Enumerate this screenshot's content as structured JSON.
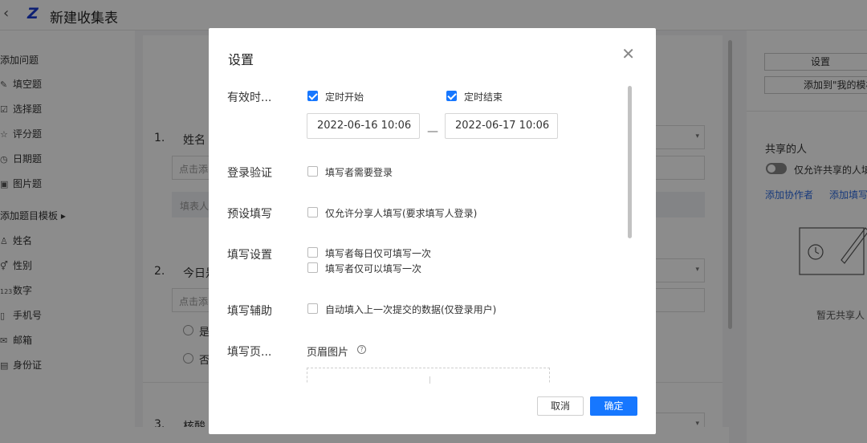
{
  "app": {
    "back_icon": "chevron-left-icon",
    "logo": "Z",
    "title": "新建收集表"
  },
  "sidebar": {
    "add_question": "添加问题",
    "items": [
      {
        "label": "填空题",
        "icon": "pencil-icon",
        "glyph": "✎"
      },
      {
        "label": "选择题",
        "icon": "checkbox-icon",
        "glyph": "☑"
      },
      {
        "label": "评分题",
        "icon": "star-icon",
        "glyph": "☆"
      },
      {
        "label": "日期题",
        "icon": "clock-icon",
        "glyph": "◷"
      },
      {
        "label": "图片题",
        "icon": "image-icon",
        "glyph": "▣"
      }
    ],
    "template_head": "添加题目模板",
    "template_items": [
      {
        "label": "姓名",
        "icon": "user-icon",
        "glyph": "♙"
      },
      {
        "label": "性别",
        "icon": "gender-icon",
        "glyph": "⚥"
      },
      {
        "label": "数字",
        "icon": "number-icon",
        "glyph": "123"
      },
      {
        "label": "手机号",
        "icon": "phone-icon",
        "glyph": "▯"
      },
      {
        "label": "邮箱",
        "icon": "mail-icon",
        "glyph": "✉"
      },
      {
        "label": "身份证",
        "icon": "id-card-icon",
        "glyph": "▤"
      }
    ]
  },
  "canvas": {
    "q1_num": "1.",
    "q1_title": "姓名",
    "q1_hint": "点击添",
    "q1_band": "填表人",
    "q2_num": "2.",
    "q2_title": "今日是",
    "q2_hint": "点击添",
    "q2_opt1": "是",
    "q2_opt2": "否",
    "q3_num": "3.",
    "q3_title": "核酸"
  },
  "right_panel": {
    "settings_btn": "设置",
    "add_template_btn": "添加到\"我的模板",
    "share_title": "共享的人",
    "share_toggle": "仅允许共享的人填",
    "add_collab": "添加协作者",
    "add_filler": "添加填写",
    "empty_text": "暂无共享人"
  },
  "modal": {
    "title": "设置",
    "close_icon": "close-icon",
    "rows": {
      "valid_time": "有效时...",
      "login": "登录验证",
      "preset": "预设填写",
      "fill_settings": "填写设置",
      "assist": "填写辅助",
      "page": "填写页..."
    },
    "timed_start": {
      "label": "定时开始",
      "checked": true
    },
    "timed_end": {
      "label": "定时结束",
      "checked": true
    },
    "start_datetime": "2022-06-16 10:06",
    "end_datetime": "2022-06-17 10:06",
    "dash": "—",
    "require_login": {
      "label": "填写者需要登录",
      "checked": false
    },
    "share_only": {
      "label": "仅允许分享人填写(要求填写人登录)",
      "checked": false
    },
    "once_daily": {
      "label": "填写者每日仅可填写一次",
      "checked": false
    },
    "once_only": {
      "label": "填写者仅可以填写一次",
      "checked": false
    },
    "autofill": {
      "label": "自动填入上一次提交的数据(仅登录用户)",
      "checked": false
    },
    "header_image": "页眉图片",
    "help_icon": "help-circle-icon",
    "cancel": "取消",
    "ok": "确定",
    "accent": "#1677ff"
  }
}
